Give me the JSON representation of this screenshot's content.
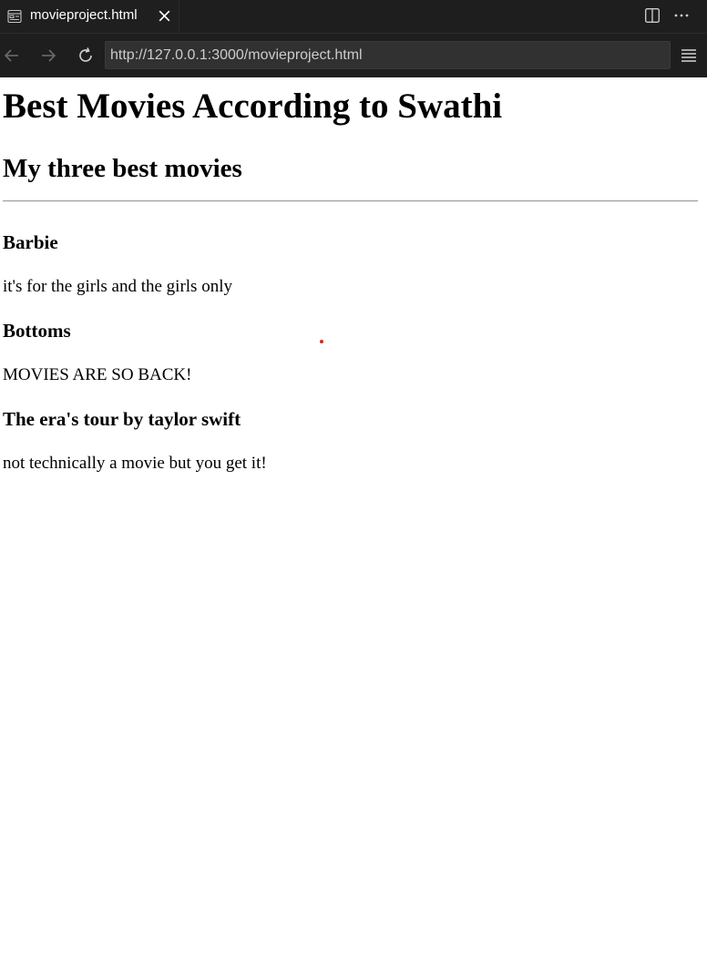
{
  "editor_tab": {
    "icon": "preview-icon",
    "title": "movieproject.html"
  },
  "toolbar": {
    "back_icon": "arrow-left-icon",
    "forward_icon": "arrow-right-icon",
    "reload_icon": "reload-icon",
    "url": "http://127.0.0.1:3000/movieproject.html",
    "menu_icon": "hamburger-menu-icon",
    "split_icon": "split-editor-icon",
    "more_icon": "more-actions-icon"
  },
  "page": {
    "heading": "Best Movies According to Swathi",
    "subheading": "My three best movies",
    "movies": [
      {
        "title": "Barbie",
        "description": "it's for the girls and the girls only"
      },
      {
        "title": "Bottoms",
        "description": "MOVIES ARE SO BACK!"
      },
      {
        "title": "The era's tour by taylor swift",
        "description": "not technically a movie but you get it!"
      }
    ]
  },
  "colors": {
    "chrome_background": "#1e1e1e",
    "url_field_background": "#313131",
    "page_background": "#ffffff",
    "cursor_dot": "#e0241c"
  }
}
